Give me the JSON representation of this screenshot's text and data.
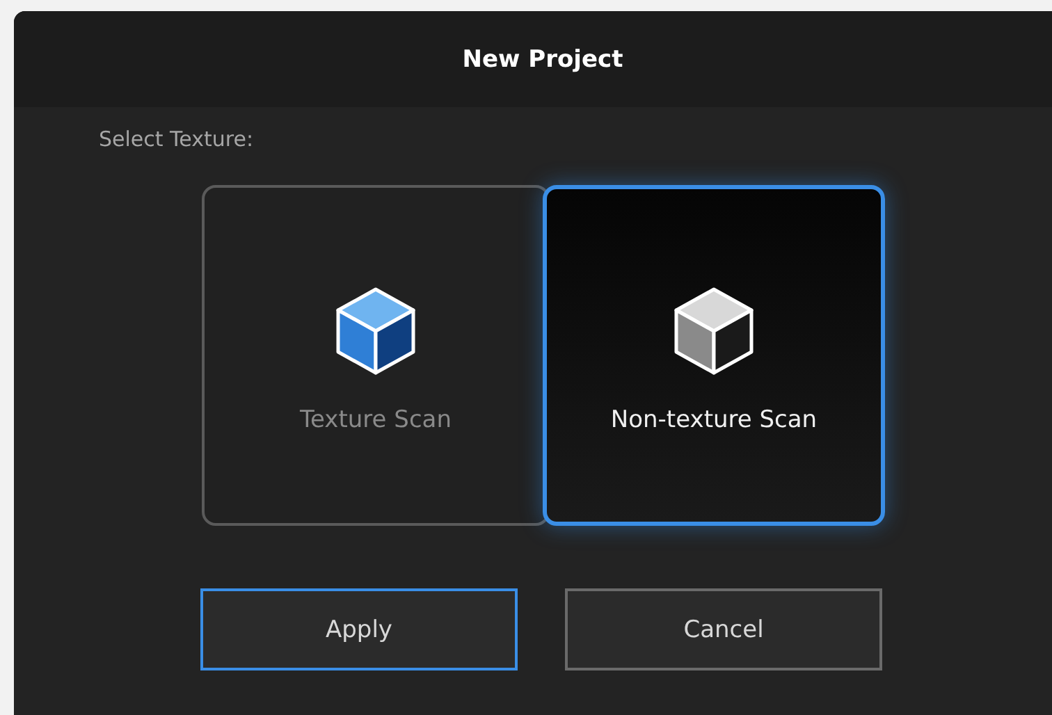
{
  "dialog": {
    "title": "New Project"
  },
  "section_label": "Select Texture:",
  "options": [
    {
      "label": "Texture Scan",
      "kind": "color",
      "selected": false
    },
    {
      "label": "Non-texture Scan",
      "kind": "gray",
      "selected": true
    }
  ],
  "buttons": [
    {
      "label": "Apply",
      "focused": true
    },
    {
      "label": "Cancel",
      "focused": false
    }
  ]
}
